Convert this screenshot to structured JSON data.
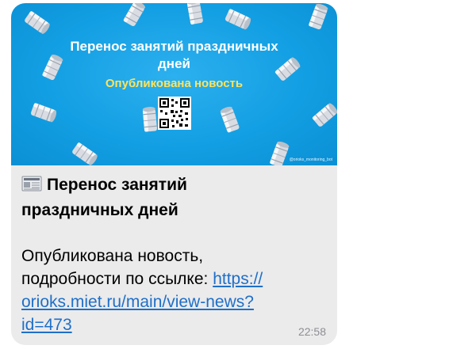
{
  "banner": {
    "title_line1": "Перенос занятий праздничных",
    "title_line2": "дней",
    "subtitle": "Опубликована новость",
    "handle": "@orioks_monitoring_bot",
    "colors": {
      "background": "#139fe3",
      "title": "#ffffff",
      "subtitle": "#ffe35a"
    }
  },
  "message": {
    "icon": "newspaper-icon",
    "title_line1": "Перенос занятий",
    "title_line2": "праздничных дней",
    "body_line1": "Опубликована новость,",
    "body_line2_prefix": "подробности по ссылке: ",
    "link_part1": "https://",
    "link_part2": "orioks.miet.ru/main/view-news?",
    "link_part3": "id=473",
    "time": "22:58",
    "link_color": "#1f6fc8"
  }
}
